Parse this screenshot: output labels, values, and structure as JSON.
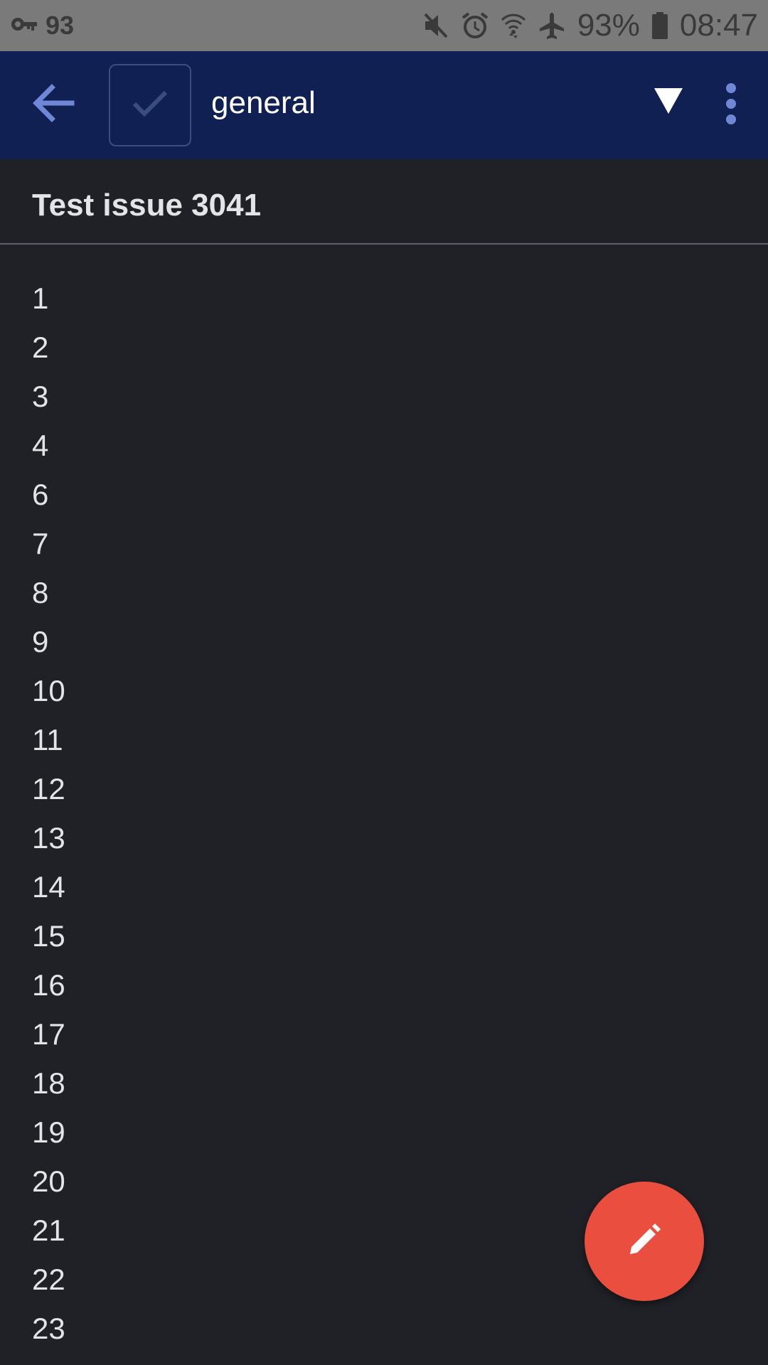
{
  "status_bar": {
    "left_number": "93",
    "battery_percent": "93%",
    "time": "08:47",
    "icons": [
      "key-icon",
      "mute-icon",
      "alarm-icon",
      "wifi-icon",
      "airplane-icon",
      "battery-icon"
    ]
  },
  "app_bar": {
    "category": "general",
    "background_color": "#112052",
    "accent_color": "#6f87d6"
  },
  "note": {
    "title": "Test issue 3041",
    "lines": [
      "1",
      "2",
      "3",
      "4",
      "6",
      "7",
      "8",
      "9",
      "10",
      "11",
      "12",
      "13",
      "14",
      "15",
      "16",
      "17",
      "18",
      "19",
      "20",
      "21",
      "22",
      "23"
    ]
  },
  "fab": {
    "icon": "pencil-icon",
    "color": "#e94e3f"
  }
}
